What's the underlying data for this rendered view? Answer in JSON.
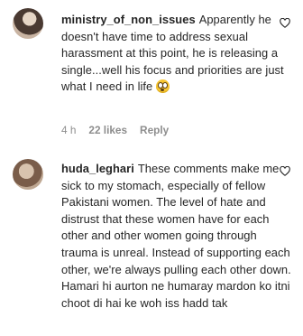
{
  "comments": [
    {
      "username": "ministry_of_non_issues",
      "text": "Apparently he doesn't have time to address sexual harassment at this point, he is releasing a single...well his focus and priorities are just what I need in life",
      "emoji_icon": "flushed-face-emoji",
      "time": "4 h",
      "likes": "22 likes",
      "reply": "Reply"
    },
    {
      "username": "huda_leghari",
      "text": "These comments make me sick to my stomach, especially of fellow Pakistani women. The level of hate and distrust that these women have for each other and other women going through trauma is unreal. Instead of supporting each other, we're always pulling each other down. Hamari hi aurton ne humaray mardon ko itni choot di hai ke woh iss hadd tak"
    }
  ]
}
